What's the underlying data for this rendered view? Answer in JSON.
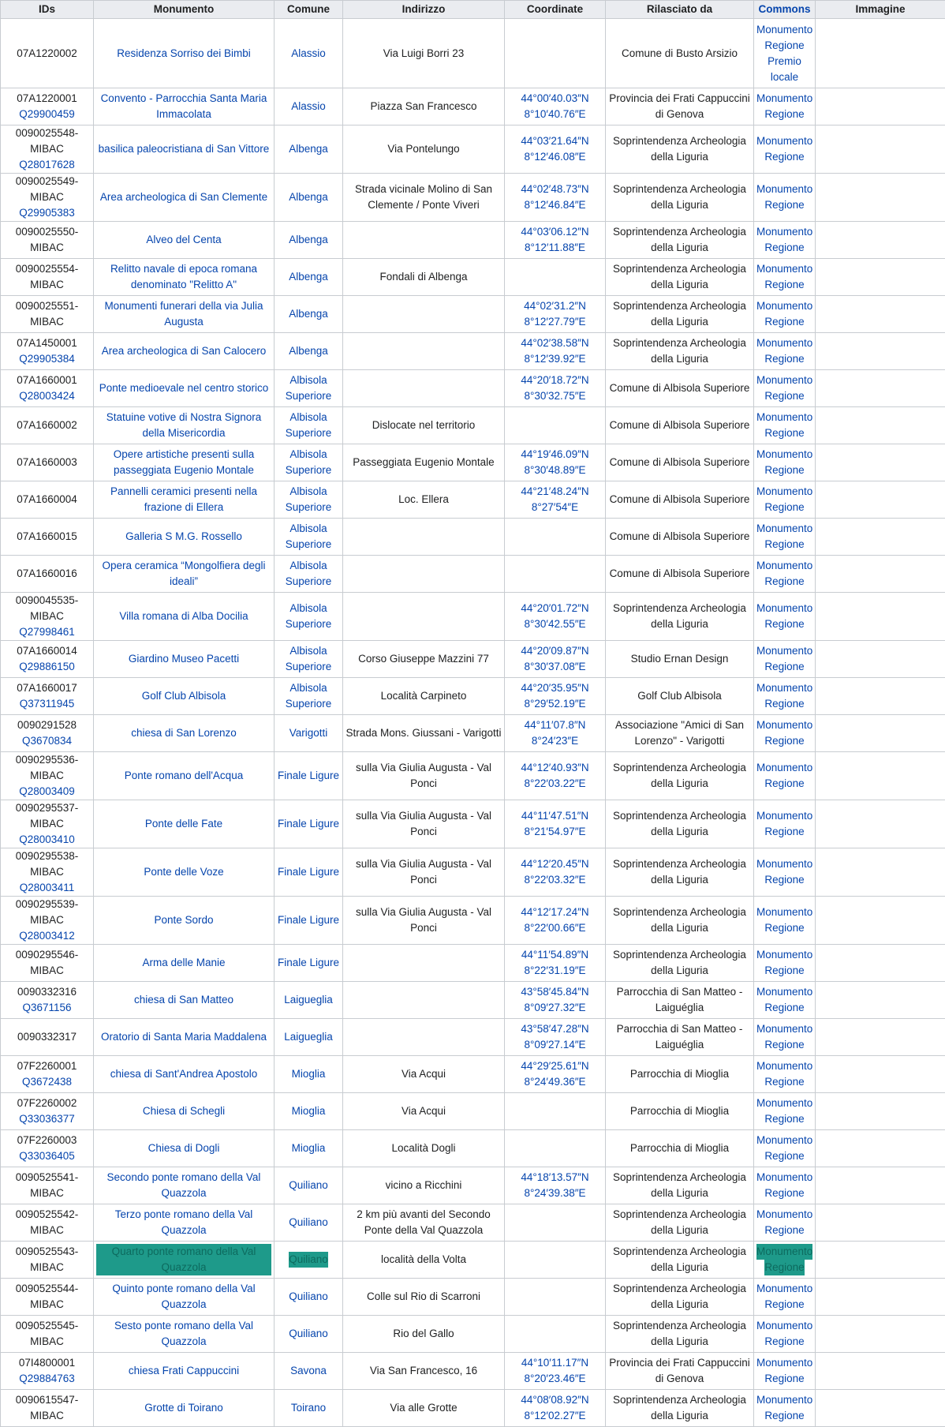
{
  "headers": [
    "IDs",
    "Monumento",
    "Comune",
    "Indirizzo",
    "Coordinate",
    "Rilasciato da",
    "Commons",
    "Immagine"
  ],
  "rows": [
    {
      "id": "07A1220002",
      "wd": "",
      "mon": "Residenza Sorriso dei Bimbi",
      "com": "Alassio",
      "ind": "Via Luigi Borri 23",
      "c1": "",
      "c2": "",
      "ril": "Comune di Busto Arsizio",
      "cm": [
        "Monumento",
        "Regione",
        "Premio",
        "locale"
      ]
    },
    {
      "id": "07A1220001",
      "wd": "Q29900459",
      "mon": "Convento - Parrocchia Santa Maria Immacolata",
      "com": "Alassio",
      "ind": "Piazza San Francesco",
      "c1": "44°00′40.03″N",
      "c2": "8°10′40.76″E",
      "ril": "Provincia dei Frati Cappuccini di Genova",
      "cm": [
        "Monumento",
        "Regione"
      ]
    },
    {
      "id": "0090025548-MIBAC",
      "wd": "Q28017628",
      "mon": "basilica paleocristiana di San Vittore",
      "com": "Albenga",
      "ind": "Via Pontelungo",
      "c1": "44°03′21.64″N",
      "c2": "8°12′46.08″E",
      "ril": "Soprintendenza Archeologia della Liguria",
      "cm": [
        "Monumento",
        "Regione"
      ]
    },
    {
      "id": "0090025549-MIBAC",
      "wd": "Q29905383",
      "mon": "Area archeologica di San Clemente",
      "com": "Albenga",
      "ind": "Strada vicinale Molino di San Clemente / Ponte Viveri",
      "c1": "44°02′48.73″N",
      "c2": "8°12′46.84″E",
      "ril": "Soprintendenza Archeologia della Liguria",
      "cm": [
        "Monumento",
        "Regione"
      ]
    },
    {
      "id": "0090025550-MIBAC",
      "wd": "",
      "mon": "Alveo del Centa",
      "com": "Albenga",
      "ind": "",
      "c1": "44°03′06.12″N",
      "c2": "8°12′11.88″E",
      "ril": "Soprintendenza Archeologia della Liguria",
      "cm": [
        "Monumento",
        "Regione"
      ]
    },
    {
      "id": "0090025554-MIBAC",
      "wd": "",
      "mon": "Relitto navale di epoca romana denominato \"Relitto A\"",
      "com": "Albenga",
      "ind": "Fondali di Albenga",
      "c1": "",
      "c2": "",
      "ril": "Soprintendenza Archeologia della Liguria",
      "cm": [
        "Monumento",
        "Regione"
      ]
    },
    {
      "id": "0090025551-MIBAC",
      "wd": "",
      "mon": "Monumenti funerari della via Julia Augusta",
      "com": "Albenga",
      "ind": "",
      "c1": "44°02′31.2″N",
      "c2": "8°12′27.79″E",
      "ril": "Soprintendenza Archeologia della Liguria",
      "cm": [
        "Monumento",
        "Regione"
      ]
    },
    {
      "id": "07A1450001",
      "wd": "Q29905384",
      "mon": "Area archeologica di San Calocero",
      "com": "Albenga",
      "ind": "",
      "c1": "44°02′38.58″N",
      "c2": "8°12′39.92″E",
      "ril": "Soprintendenza Archeologia della Liguria",
      "cm": [
        "Monumento",
        "Regione"
      ]
    },
    {
      "id": "07A1660001",
      "wd": "Q28003424",
      "mon": "Ponte medioevale nel centro storico",
      "com": "Albisola Superiore",
      "ind": "",
      "c1": "44°20′18.72″N",
      "c2": "8°30′32.75″E",
      "ril": "Comune di Albisola Superiore",
      "cm": [
        "Monumento",
        "Regione"
      ]
    },
    {
      "id": "07A1660002",
      "wd": "",
      "mon": "Statuine votive di Nostra Signora della Misericordia",
      "com": "Albisola Superiore",
      "ind": "Dislocate nel territorio",
      "c1": "",
      "c2": "",
      "ril": "Comune di Albisola Superiore",
      "cm": [
        "Monumento",
        "Regione"
      ]
    },
    {
      "id": "07A1660003",
      "wd": "",
      "mon": "Opere artistiche presenti sulla passeggiata Eugenio Montale",
      "com": "Albisola Superiore",
      "ind": "Passeggiata Eugenio Montale",
      "c1": "44°19′46.09″N",
      "c2": "8°30′48.89″E",
      "ril": "Comune di Albisola Superiore",
      "cm": [
        "Monumento",
        "Regione"
      ]
    },
    {
      "id": "07A1660004",
      "wd": "",
      "mon": "Pannelli ceramici presenti nella frazione di Ellera",
      "com": "Albisola Superiore",
      "ind": "Loc. Ellera",
      "c1": "44°21′48.24″N",
      "c2": "8°27′54″E",
      "ril": "Comune di Albisola Superiore",
      "cm": [
        "Monumento",
        "Regione"
      ]
    },
    {
      "id": "07A1660015",
      "wd": "",
      "mon": "Galleria S M.G. Rossello",
      "com": "Albisola Superiore",
      "ind": "",
      "c1": "",
      "c2": "",
      "ril": "Comune di Albisola Superiore",
      "cm": [
        "Monumento",
        "Regione"
      ]
    },
    {
      "id": "07A1660016",
      "wd": "",
      "mon": "Opera ceramica “Mongolfiera degli ideali”",
      "com": "Albisola Superiore",
      "ind": "",
      "c1": "",
      "c2": "",
      "ril": "Comune di Albisola Superiore",
      "cm": [
        "Monumento",
        "Regione"
      ]
    },
    {
      "id": "0090045535-MIBAC",
      "wd": "Q27998461",
      "mon": "Villa romana di Alba Docilia",
      "com": "Albisola Superiore",
      "ind": "",
      "c1": "44°20′01.72″N",
      "c2": "8°30′42.55″E",
      "ril": "Soprintendenza Archeologia della Liguria",
      "cm": [
        "Monumento",
        "Regione"
      ]
    },
    {
      "id": "07A1660014",
      "wd": "Q29886150",
      "mon": "Giardino Museo Pacetti",
      "com": "Albisola Superiore",
      "ind": "Corso Giuseppe Mazzini 77",
      "c1": "44°20′09.87″N",
      "c2": "8°30′37.08″E",
      "ril": "Studio Ernan Design",
      "cm": [
        "Monumento",
        "Regione"
      ]
    },
    {
      "id": "07A1660017",
      "wd": "Q37311945",
      "mon": "Golf Club Albisola",
      "com": "Albisola Superiore",
      "ind": "Località Carpineto",
      "c1": "44°20′35.95″N",
      "c2": "8°29′52.19″E",
      "ril": "Golf Club Albisola",
      "cm": [
        "Monumento",
        "Regione"
      ]
    },
    {
      "id": "0090291528",
      "wd": "Q3670834",
      "mon": "chiesa di San Lorenzo",
      "com": "Varigotti",
      "ind": "Strada Mons. Giussani - Varigotti",
      "c1": "44°11′07.8″N",
      "c2": "8°24′23″E",
      "ril": "Associazione \"Amici di San Lorenzo\" - Varigotti",
      "cm": [
        "Monumento",
        "Regione"
      ]
    },
    {
      "id": "0090295536-MIBAC",
      "wd": "Q28003409",
      "mon": "Ponte romano dell'Acqua",
      "com": "Finale Ligure",
      "ind": "sulla Via Giulia Augusta - Val Ponci",
      "c1": "44°12′40.93″N",
      "c2": "8°22′03.22″E",
      "ril": "Soprintendenza Archeologia della Liguria",
      "cm": [
        "Monumento",
        "Regione"
      ]
    },
    {
      "id": "0090295537-MIBAC",
      "wd": "Q28003410",
      "mon": "Ponte delle Fate",
      "com": "Finale Ligure",
      "ind": "sulla Via Giulia Augusta - Val Ponci",
      "c1": "44°11′47.51″N",
      "c2": "8°21′54.97″E",
      "ril": "Soprintendenza Archeologia della Liguria",
      "cm": [
        "Monumento",
        "Regione"
      ]
    },
    {
      "id": "0090295538-MIBAC",
      "wd": "Q28003411",
      "mon": "Ponte delle Voze",
      "com": "Finale Ligure",
      "ind": "sulla Via Giulia Augusta - Val Ponci",
      "c1": "44°12′20.45″N",
      "c2": "8°22′03.32″E",
      "ril": "Soprintendenza Archeologia della Liguria",
      "cm": [
        "Monumento",
        "Regione"
      ]
    },
    {
      "id": "0090295539-MIBAC",
      "wd": "Q28003412",
      "mon": "Ponte Sordo",
      "com": "Finale Ligure",
      "ind": "sulla Via Giulia Augusta - Val Ponci",
      "c1": "44°12′17.24″N",
      "c2": "8°22′00.66″E",
      "ril": "Soprintendenza Archeologia della Liguria",
      "cm": [
        "Monumento",
        "Regione"
      ]
    },
    {
      "id": "0090295546-MIBAC",
      "wd": "",
      "mon": "Arma delle Manie",
      "com": "Finale Ligure",
      "ind": "",
      "c1": "44°11′54.89″N",
      "c2": "8°22′31.19″E",
      "ril": "Soprintendenza Archeologia della Liguria",
      "cm": [
        "Monumento",
        "Regione"
      ]
    },
    {
      "id": "0090332316",
      "wd": "Q3671156",
      "mon": "chiesa di San Matteo",
      "com": "Laigueglia",
      "ind": "",
      "c1": "43°58′45.84″N",
      "c2": "8°09′27.32″E",
      "ril": "Parrocchia di San Matteo - Laiguéglia",
      "cm": [
        "Monumento",
        "Regione"
      ]
    },
    {
      "id": "0090332317",
      "wd": "",
      "mon": "Oratorio di Santa Maria Maddalena",
      "com": "Laigueglia",
      "ind": "",
      "c1": "43°58′47.28″N",
      "c2": "8°09′27.14″E",
      "ril": "Parrocchia di San Matteo - Laiguéglia",
      "cm": [
        "Monumento",
        "Regione"
      ]
    },
    {
      "id": "07F2260001",
      "wd": "Q3672438",
      "mon": "chiesa di Sant'Andrea Apostolo",
      "com": "Mioglia",
      "ind": "Via Acqui",
      "c1": "44°29′25.61″N",
      "c2": "8°24′49.36″E",
      "ril": "Parrocchia di Mioglia",
      "cm": [
        "Monumento",
        "Regione"
      ]
    },
    {
      "id": "07F2260002",
      "wd": "Q33036377",
      "mon": "Chiesa di Schegli",
      "com": "Mioglia",
      "ind": "Via Acqui",
      "c1": "",
      "c2": "",
      "ril": "Parrocchia di Mioglia",
      "cm": [
        "Monumento",
        "Regione"
      ]
    },
    {
      "id": "07F2260003",
      "wd": "Q33036405",
      "mon": "Chiesa di Dogli",
      "com": "Mioglia",
      "ind": "Località Dogli",
      "c1": "",
      "c2": "",
      "ril": "Parrocchia di Mioglia",
      "cm": [
        "Monumento",
        "Regione"
      ]
    },
    {
      "id": "0090525541-MIBAC",
      "wd": "",
      "mon": "Secondo ponte romano della Val Quazzola",
      "com": "Quiliano",
      "ind": "vicino a Ricchini",
      "c1": "44°18′13.57″N",
      "c2": "8°24′39.38″E",
      "ril": "Soprintendenza Archeologia della Liguria",
      "cm": [
        "Monumento",
        "Regione"
      ]
    },
    {
      "id": "0090525542-MIBAC",
      "wd": "",
      "mon": "Terzo ponte romano della Val Quazzola",
      "com": "Quiliano",
      "ind": "2 km più avanti del Secondo Ponte della Val Quazzola",
      "c1": "",
      "c2": "",
      "ril": "Soprintendenza Archeologia della Liguria",
      "cm": [
        "Monumento",
        "Regione"
      ]
    },
    {
      "id": "0090525543-MIBAC",
      "wd": "",
      "mon": "Quarto ponte romano della Val Quazzola",
      "com": "Quiliano",
      "ind": "località della Volta",
      "c1": "",
      "c2": "",
      "ril": "Soprintendenza Archeologia della Liguria",
      "cm": [
        "Monumento",
        "Regione"
      ],
      "sel": true
    },
    {
      "id": "0090525544-MIBAC",
      "wd": "",
      "mon": "Quinto ponte romano della Val Quazzola",
      "com": "Quiliano",
      "ind": "Colle sul Rio di Scarroni",
      "c1": "",
      "c2": "",
      "ril": "Soprintendenza Archeologia della Liguria",
      "cm": [
        "Monumento",
        "Regione"
      ]
    },
    {
      "id": "0090525545-MIBAC",
      "wd": "",
      "mon": "Sesto ponte romano della Val Quazzola",
      "com": "Quiliano",
      "ind": "Rio del Gallo",
      "c1": "",
      "c2": "",
      "ril": "Soprintendenza Archeologia della Liguria",
      "cm": [
        "Monumento",
        "Regione"
      ]
    },
    {
      "id": "07I4800001",
      "wd": "Q29884763",
      "mon": "chiesa Frati Cappuccini",
      "com": "Savona",
      "ind": "Via San Francesco, 16",
      "c1": "44°10′11.17″N",
      "c2": "8°20′23.46″E",
      "ril": "Provincia dei Frati Cappuccini di Genova",
      "cm": [
        "Monumento",
        "Regione"
      ]
    },
    {
      "id": "0090615547-MIBAC",
      "wd": "",
      "mon": "Grotte di Toirano",
      "com": "Toirano",
      "ind": "Via alle Grotte",
      "c1": "44°08′08.92″N",
      "c2": "8°12′02.27″E",
      "ril": "Soprintendenza Archeologia della Liguria",
      "cm": [
        "Monumento",
        "Regione"
      ]
    }
  ]
}
